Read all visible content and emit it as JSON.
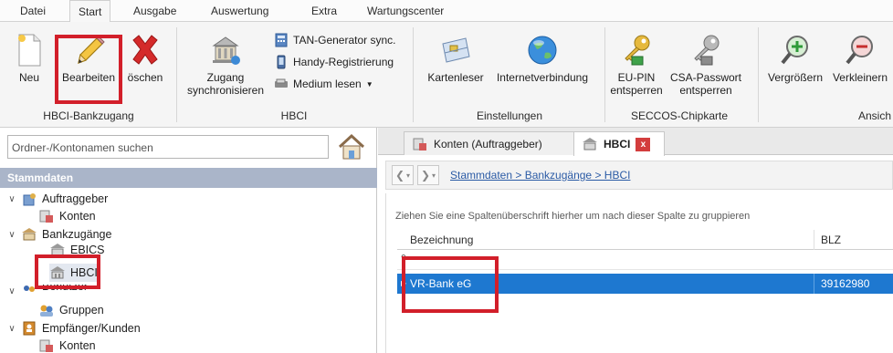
{
  "menu": {
    "tabs": [
      "Datei",
      "Start",
      "Ausgabe",
      "Auswertung",
      "Extra",
      "Wartungscenter"
    ],
    "active": "Start"
  },
  "ribbon": {
    "hbci_bankzugang": {
      "label": "HBCI-Bankzugang",
      "neu": "Neu",
      "bearbeiten": "Bearbeiten",
      "loeschen": "öschen"
    },
    "hbci": {
      "label": "HBCI",
      "zugang_line1": "Zugang",
      "zugang_line2": "synchronisieren",
      "tan": "TAN-Generator sync.",
      "handy": "Handy-Registrierung",
      "medium": "Medium lesen"
    },
    "einstellungen": {
      "label": "Einstellungen",
      "kartenleser": "Kartenleser",
      "internet": "Internetverbindung"
    },
    "seccos": {
      "label": "SECCOS-Chipkarte",
      "eupin_line1": "EU-PIN",
      "eupin_line2": "entsperren",
      "csa_line1": "CSA-Passwort",
      "csa_line2": "entsperren"
    },
    "ansicht": {
      "label": "Ansich",
      "vergroessern": "Vergrößern",
      "verkleinern": "Verkleinern"
    }
  },
  "sidebar": {
    "search_placeholder": "Ordner-/Kontonamen suchen",
    "section": "Stammdaten",
    "tree": {
      "auftraggeber": "Auftraggeber",
      "konten": "Konten",
      "bankzugaenge": "Bankzugänge",
      "ebics": "EBICS",
      "hbci": "HBCI",
      "benutzer": "Benutzer",
      "gruppen": "Gruppen",
      "empfaenger": "Empfänger/Kunden",
      "konten2": "Konten"
    }
  },
  "main": {
    "tabs": {
      "konten": "Konten (Auftraggeber)",
      "hbci": "HBCI",
      "close": "x"
    },
    "breadcrumb": "Stammdaten > Bankzugänge > HBCI",
    "group_hint": "Ziehen Sie eine Spaltenüberschrift hierher um nach dieser Spalte zu gruppieren",
    "columns": [
      "Bezeichnung",
      "BLZ"
    ],
    "rows": [
      {
        "bezeichnung": "VR-Bank eG",
        "blz": "39162980"
      }
    ]
  },
  "colors": {
    "highlight": "#d21f2a",
    "selection": "#1e78d0",
    "section_header": "#aab5c9",
    "link": "#2a5aa5"
  }
}
